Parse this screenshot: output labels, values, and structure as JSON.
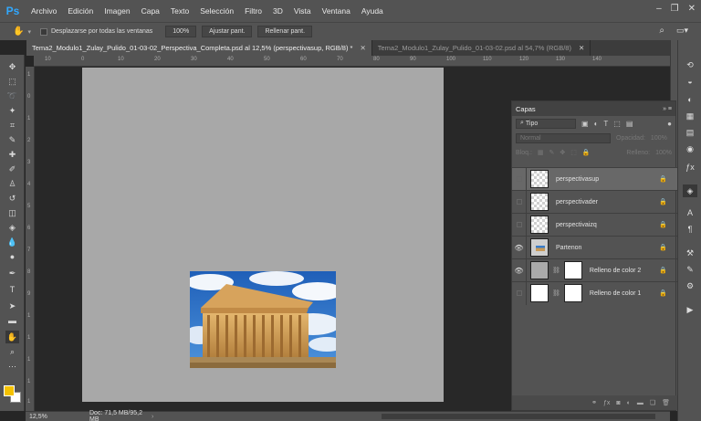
{
  "app": {
    "logo": "Ps"
  },
  "menu": [
    "Archivo",
    "Edición",
    "Imagen",
    "Capa",
    "Texto",
    "Selección",
    "Filtro",
    "3D",
    "Vista",
    "Ventana",
    "Ayuda"
  ],
  "window_controls": [
    "–",
    "❐",
    "✕"
  ],
  "options_bar": {
    "scroll_all_windows_label": "Desplazarse por todas las ventanas",
    "zoom_value": "100%",
    "fit_screen_label": "Ajustar pant.",
    "fill_screen_label": "Rellenar pant."
  },
  "tabs": [
    {
      "label": "Tema2_Modulo1_Zulay_Pulido_01-03-02_Perspectiva_Completa.psd al 12,5% (perspectivasup, RGB/8) *",
      "close": "✕",
      "active": true
    },
    {
      "label": "Tema2_Modulo1_Zulay_Pulido_01-03-02.psd al 54,7% (RGB/8)",
      "close": "✕",
      "active": false
    }
  ],
  "ruler": {
    "top_labels": [
      "10",
      "0",
      "10",
      "20",
      "30",
      "40",
      "50",
      "60",
      "70",
      "80",
      "90",
      "100",
      "110",
      "120",
      "130",
      "140"
    ],
    "left_labels": [
      "1",
      "0",
      "1",
      "2",
      "3",
      "4",
      "5",
      "6",
      "7",
      "8",
      "9",
      "1",
      "1",
      "1",
      "1",
      "1"
    ]
  },
  "status": {
    "zoom": "12,5%",
    "doc": "Doc: 71,5 MB/95,2 MB",
    "arrow": "›"
  },
  "layers_panel": {
    "title": "Capas",
    "controls": "»  ≡",
    "filter_label": "Tipo",
    "blend_mode": "Normal",
    "opacity_label": "Opacidad:",
    "opacity_value": "100%",
    "lock_label": "Bloq.:",
    "fill_label": "Relleno:",
    "fill_value": "100%",
    "layers": [
      {
        "name": "perspectivasup",
        "visible": false,
        "selected": true
      },
      {
        "name": "perspectivader",
        "visible": false,
        "selected": false
      },
      {
        "name": "perspectivaizq",
        "visible": false,
        "selected": false
      },
      {
        "name": "Partenon",
        "visible": true,
        "selected": false
      },
      {
        "name": "Relleno de color 2",
        "visible": true,
        "selected": false
      },
      {
        "name": "Relleno de color 1",
        "visible": false,
        "selected": false
      }
    ],
    "footer_icons": [
      "link-icon",
      "fx-icon",
      "mask-icon",
      "adjustment-icon",
      "folder-icon",
      "new-layer-icon",
      "trash-icon"
    ]
  },
  "colors": {
    "foreground": "#f5c200",
    "background": "#ffffff",
    "accent": "#31a8ff"
  }
}
